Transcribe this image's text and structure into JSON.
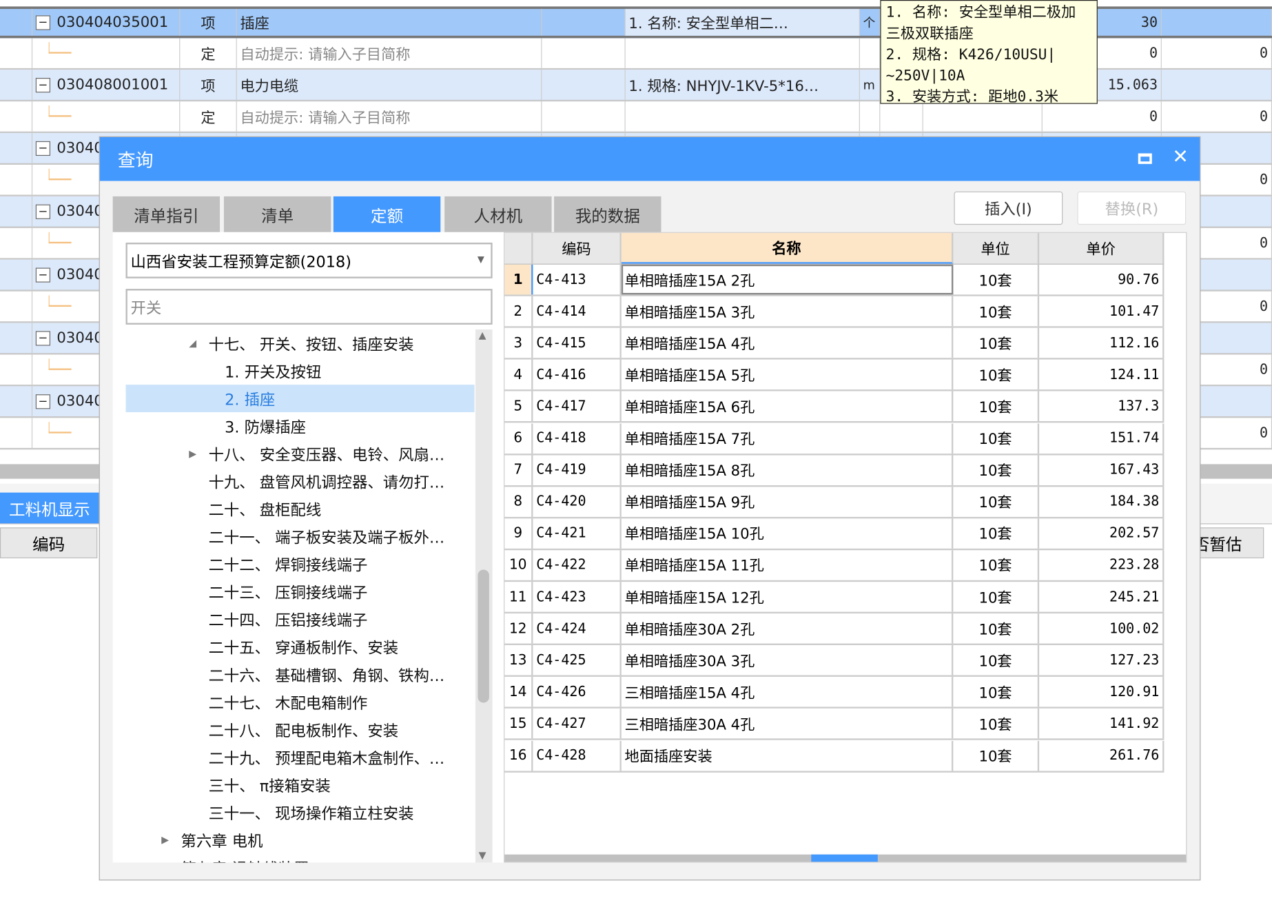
{
  "background_grid": {
    "rows": [
      {
        "code": "030404035001",
        "type": "项",
        "name": "插座",
        "feature": "1. 名称: 安全型单相二…",
        "unit": "个",
        "qty": "30",
        "extra": "",
        "selected": true
      },
      {
        "code": "",
        "type": "定",
        "name": "自动提示: 请输入子目简称",
        "feature": "",
        "unit": "",
        "qty": "0",
        "extra": "0",
        "hint": true
      },
      {
        "code": "030408001001",
        "type": "项",
        "name": "电力电缆",
        "feature": "1. 规格: NHYJV-1KV-5*16…",
        "unit": "m",
        "qty": "15.063",
        "extra": ""
      },
      {
        "code": "",
        "type": "定",
        "name": "自动提示: 请输入子目简称",
        "feature": "",
        "unit": "",
        "qty": "0",
        "extra": "0",
        "hint": true
      },
      {
        "code": "03040",
        "type": "",
        "name": "",
        "feature": "",
        "unit": "",
        "qty": "",
        "extra": ""
      },
      {
        "code": "",
        "type": "",
        "name": "",
        "feature": "",
        "unit": "",
        "qty": "",
        "extra": "0"
      },
      {
        "code": "03040",
        "type": "",
        "name": "",
        "feature": "",
        "unit": "",
        "qty": "",
        "extra": ""
      },
      {
        "code": "",
        "type": "",
        "name": "",
        "feature": "",
        "unit": "",
        "qty": "",
        "extra": "0"
      },
      {
        "code": "03040",
        "type": "",
        "name": "",
        "feature": "",
        "unit": "",
        "qty": "",
        "extra": ""
      },
      {
        "code": "",
        "type": "",
        "name": "",
        "feature": "",
        "unit": "",
        "qty": "",
        "extra": "0"
      },
      {
        "code": "03040",
        "type": "",
        "name": "",
        "feature": "",
        "unit": "",
        "qty": "",
        "extra": ""
      },
      {
        "code": "",
        "type": "",
        "name": "",
        "feature": "",
        "unit": "",
        "qty": "",
        "extra": "0"
      },
      {
        "code": "03040",
        "type": "",
        "name": "",
        "feature": "",
        "unit": "",
        "qty": "",
        "extra": ""
      },
      {
        "code": "",
        "type": "",
        "name": "",
        "feature": "",
        "unit": "",
        "qty": "",
        "extra": "0"
      }
    ],
    "tooltip_lines": [
      "1. 名称: 安全型单相二极加",
      "三极双联插座",
      "2. 规格: K426/10USU|",
      "~250V|10A",
      "3. 安装方式: 距地0.3米"
    ],
    "bottom_tab": "工料机显示",
    "bottom_header_code": "编码",
    "bottom_header_right": "否暂估"
  },
  "dialog": {
    "title": "查询",
    "tabs": [
      {
        "label": "清单指引"
      },
      {
        "label": "清单"
      },
      {
        "label": "定额",
        "active": true
      },
      {
        "label": "人材机"
      },
      {
        "label": "我的数据"
      }
    ],
    "insert_button": "插入(I)",
    "replace_button": "替换(R)",
    "quota_select": "山西省安装工程预算定额(2018)",
    "search_value": "开关",
    "tree": [
      {
        "label": "十七、 开关、按钮、插座安装",
        "indent": 2,
        "arrow": "expanded"
      },
      {
        "label": "1. 开关及按钮",
        "indent": 3
      },
      {
        "label": "2. 插座",
        "indent": 3,
        "selected": true
      },
      {
        "label": "3. 防爆插座",
        "indent": 3
      },
      {
        "label": "十八、 安全变压器、电铃、风扇…",
        "indent": 2,
        "arrow": "collapsed"
      },
      {
        "label": "十九、 盘管风机调控器、请勿打…",
        "indent": 2
      },
      {
        "label": "二十、 盘柜配线",
        "indent": 2
      },
      {
        "label": "二十一、 端子板安装及端子板外…",
        "indent": 2
      },
      {
        "label": "二十二、 焊铜接线端子",
        "indent": 2
      },
      {
        "label": "二十三、 压铜接线端子",
        "indent": 2
      },
      {
        "label": "二十四、 压铝接线端子",
        "indent": 2
      },
      {
        "label": "二十五、 穿通板制作、安装",
        "indent": 2
      },
      {
        "label": "二十六、 基础槽钢、角钢、铁构…",
        "indent": 2
      },
      {
        "label": "二十七、 木配电箱制作",
        "indent": 2
      },
      {
        "label": "二十八、 配电板制作、安装",
        "indent": 2
      },
      {
        "label": "二十九、 预埋配电箱木盒制作、…",
        "indent": 2
      },
      {
        "label": "三十、 π接箱安装",
        "indent": 2
      },
      {
        "label": "三十一、 现场操作箱立柱安装",
        "indent": 2
      },
      {
        "label": "第六章 电机",
        "indent": 1,
        "arrow": "collapsed"
      },
      {
        "label": "第七章 滑触线装置",
        "indent": 1
      }
    ],
    "table": {
      "headers": {
        "code": "编码",
        "name": "名称",
        "unit": "单位",
        "price": "单价"
      },
      "rows": [
        {
          "n": "1",
          "code": "C4-413",
          "name": "单相暗插座15A 2孔",
          "unit": "10套",
          "price": "90.76"
        },
        {
          "n": "2",
          "code": "C4-414",
          "name": "单相暗插座15A 3孔",
          "unit": "10套",
          "price": "101.47"
        },
        {
          "n": "3",
          "code": "C4-415",
          "name": "单相暗插座15A 4孔",
          "unit": "10套",
          "price": "112.16"
        },
        {
          "n": "4",
          "code": "C4-416",
          "name": "单相暗插座15A 5孔",
          "unit": "10套",
          "price": "124.11"
        },
        {
          "n": "5",
          "code": "C4-417",
          "name": "单相暗插座15A 6孔",
          "unit": "10套",
          "price": "137.3"
        },
        {
          "n": "6",
          "code": "C4-418",
          "name": "单相暗插座15A 7孔",
          "unit": "10套",
          "price": "151.74"
        },
        {
          "n": "7",
          "code": "C4-419",
          "name": "单相暗插座15A 8孔",
          "unit": "10套",
          "price": "167.43"
        },
        {
          "n": "8",
          "code": "C4-420",
          "name": "单相暗插座15A 9孔",
          "unit": "10套",
          "price": "184.38"
        },
        {
          "n": "9",
          "code": "C4-421",
          "name": "单相暗插座15A 10孔",
          "unit": "10套",
          "price": "202.57"
        },
        {
          "n": "10",
          "code": "C4-422",
          "name": "单相暗插座15A 11孔",
          "unit": "10套",
          "price": "223.28"
        },
        {
          "n": "11",
          "code": "C4-423",
          "name": "单相暗插座15A 12孔",
          "unit": "10套",
          "price": "245.21"
        },
        {
          "n": "12",
          "code": "C4-424",
          "name": "单相暗插座30A 2孔",
          "unit": "10套",
          "price": "100.02"
        },
        {
          "n": "13",
          "code": "C4-425",
          "name": "单相暗插座30A 3孔",
          "unit": "10套",
          "price": "127.23"
        },
        {
          "n": "14",
          "code": "C4-426",
          "name": "三相暗插座15A 4孔",
          "unit": "10套",
          "price": "120.91"
        },
        {
          "n": "15",
          "code": "C4-427",
          "name": "三相暗插座30A 4孔",
          "unit": "10套",
          "price": "141.92"
        },
        {
          "n": "16",
          "code": "C4-428",
          "name": "地面插座安装",
          "unit": "10套",
          "price": "261.76"
        }
      ]
    }
  },
  "colors": {
    "accent": "#4499ff",
    "selected_row": "#a0c8f8",
    "alt_row": "#dce9fb",
    "name_header": "#fde6c8",
    "tooltip": "#ffffe1"
  }
}
